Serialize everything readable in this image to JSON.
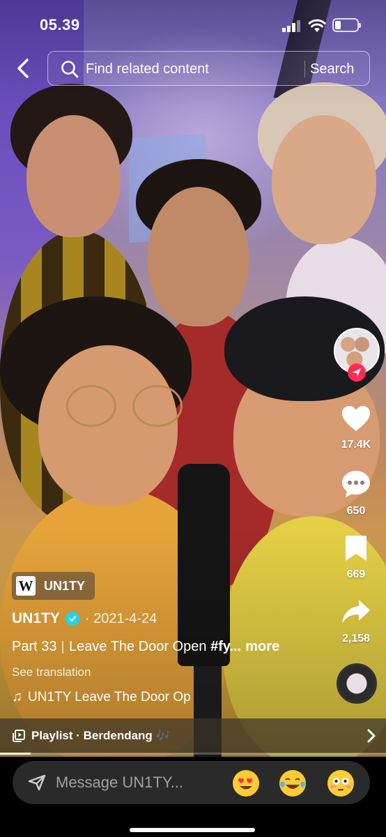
{
  "status_bar": {
    "time": "05.39"
  },
  "search": {
    "placeholder": "Find related content",
    "button_label": "Search"
  },
  "rail": {
    "likes": "17.4K",
    "comments": "650",
    "saves": "669",
    "shares": "2,158"
  },
  "caption": {
    "chip_name": "UN1TY",
    "chip_logo_letter": "W",
    "author": "UN1TY",
    "date": "· 2021-4-24",
    "part": "Part 33",
    "title": "Leave The Door Open",
    "hashtag": "#fy...",
    "more": "more",
    "translate": "See translation",
    "music": "UN1TY Leave The Door Op"
  },
  "playlist": {
    "label": "Playlist · Berdendang 🎶",
    "progress": 0.08
  },
  "message": {
    "placeholder": "Message UN1TY..."
  },
  "emojis": [
    "heart-eyes",
    "tears-of-joy",
    "flushed"
  ],
  "colors": {
    "follow": "#fe2c55",
    "verified": "#20d5ec"
  }
}
